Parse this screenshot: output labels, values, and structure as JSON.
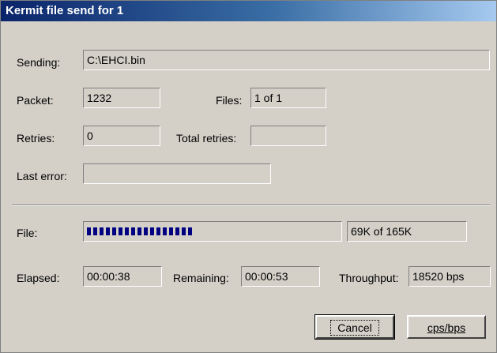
{
  "window": {
    "title": "Kermit file send for 1"
  },
  "sending": {
    "label": "Sending:",
    "value": "C:\\EHCI.bin"
  },
  "packet": {
    "label": "Packet:",
    "value": "1232"
  },
  "files": {
    "label": "Files:",
    "value": "1 of 1"
  },
  "retries": {
    "label": "Retries:",
    "value": "0"
  },
  "total_retries": {
    "label": "Total retries:",
    "value": ""
  },
  "last_error": {
    "label": "Last error:",
    "value": ""
  },
  "file_progress": {
    "label": "File:",
    "text": "69K of 165K",
    "fraction": 0.418
  },
  "elapsed": {
    "label": "Elapsed:",
    "value": "00:00:38"
  },
  "remaining": {
    "label": "Remaining:",
    "value": "00:00:53"
  },
  "throughput": {
    "label": "Throughput:",
    "value": "18520 bps"
  },
  "buttons": {
    "cancel": "Cancel",
    "cps_bps": "cps/bps"
  }
}
